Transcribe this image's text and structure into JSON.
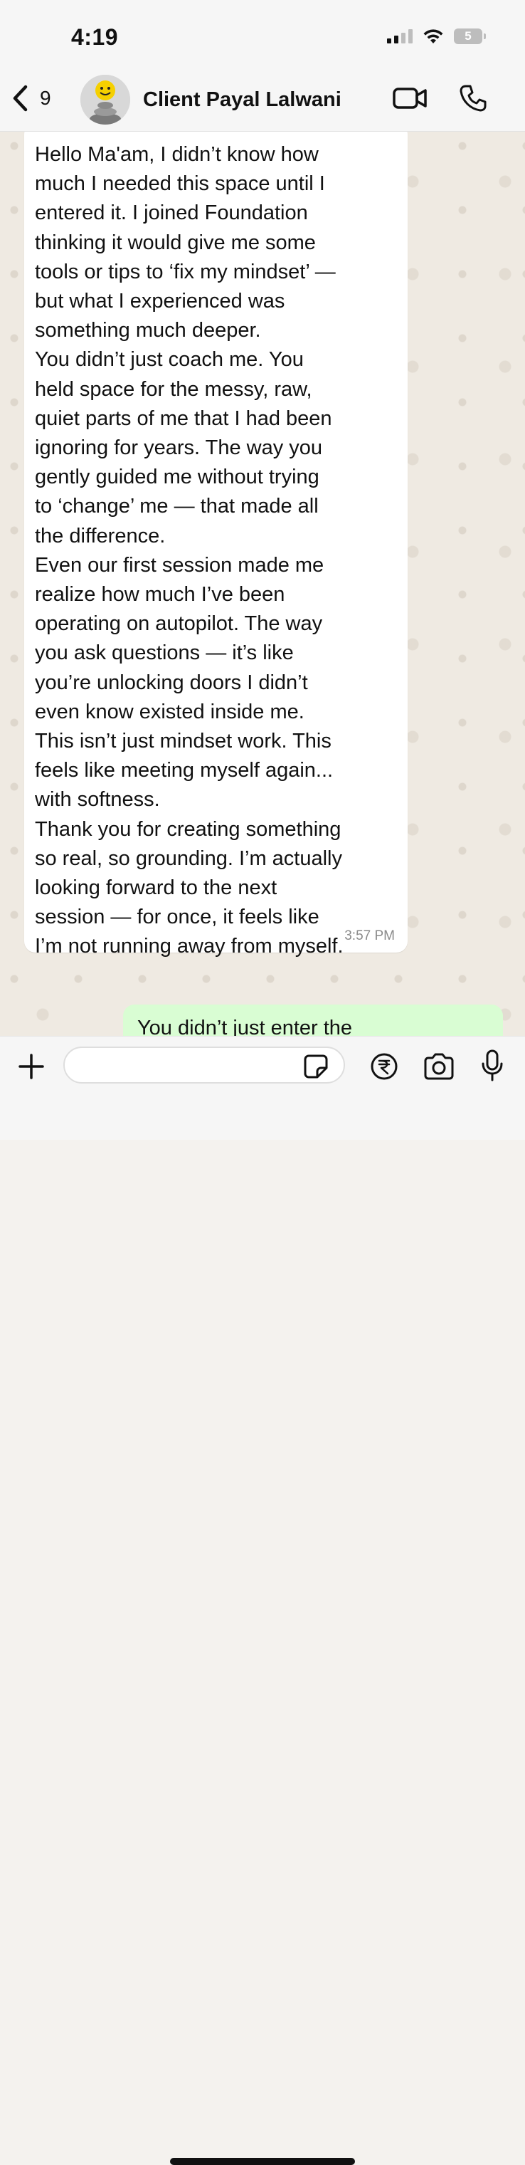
{
  "status_bar": {
    "time": "4:19",
    "battery_level": "5",
    "icons": [
      "signal-icon",
      "wifi-icon",
      "battery-icon"
    ]
  },
  "header": {
    "back_count": "9",
    "contact_name": "Client Payal Lalwani",
    "icons": [
      "chevron-left-icon",
      "avatar",
      "video-call-icon",
      "phone-icon"
    ]
  },
  "messages": [
    {
      "direction": "incoming",
      "text": "Hello Ma'am, I didn’t know how\nmuch I needed this space until I\nentered it. I joined Foundation\nthinking it would give me some\ntools or tips to ‘fix my mindset’ —\nbut what I experienced was\nsomething much deeper.\nYou didn’t just coach me. You\nheld space for the messy, raw,\nquiet parts of me that I had been\nignoring for years. The way you\ngently guided me without trying\nto ‘change’ me — that made all\nthe difference.\nEven our first session made me\nrealize how much I’ve been\noperating on autopilot. The way\nyou ask questions — it’s like\nyou’re unlocking doors I didn’t\neven know existed inside me.\nThis isn’t just mindset work. This\nfeels like meeting myself again...\nwith softness.\nThank you for creating something\nso real, so grounding. I’m actually\nlooking forward to the next\nsession — for once, it feels like\nI’m not running away from myself.",
      "time": "3:57 PM"
    },
    {
      "direction": "outgoing",
      "text": "You didn’t just enter the"
    }
  ],
  "composer": {
    "value": "",
    "placeholder": "",
    "icons": [
      "plus-icon",
      "sticker-icon",
      "rupee-icon",
      "camera-icon",
      "mic-icon"
    ]
  },
  "colors": {
    "incoming_bubble": "#ffffff",
    "outgoing_bubble": "#d9fdd3",
    "chat_background": "#efeae2",
    "bar_background": "#f6f6f6"
  }
}
